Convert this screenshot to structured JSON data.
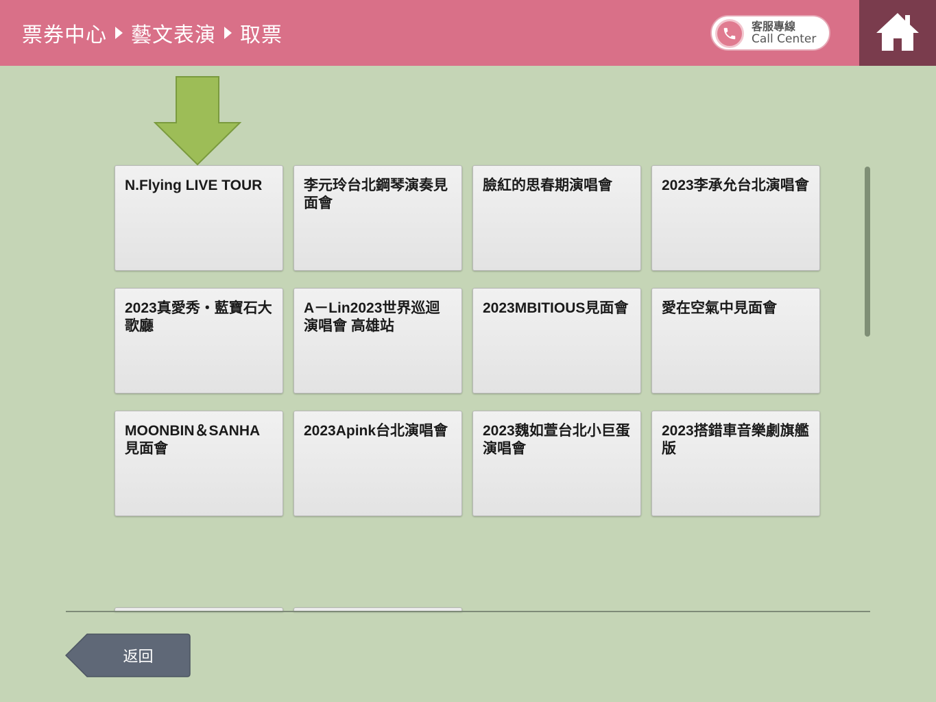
{
  "header": {
    "breadcrumb": [
      "票券中心",
      "藝文表演",
      "取票"
    ],
    "call_center": {
      "label_zh": "客服專線",
      "label_en": "Call Center",
      "icon": "phone-icon"
    },
    "home_icon": "home-icon"
  },
  "hint_arrow": {
    "icon": "down-arrow-icon",
    "color": "#9dbd57"
  },
  "events": [
    "N.Flying LIVE TOUR",
    "李元玲台北鋼琴演奏見面會",
    "臉紅的思春期演唱會",
    "2023李承允台北演唱會",
    "2023真愛秀‧藍寶石大歌廳",
    "A－Lin2023世界巡迴演唱會 高雄站",
    "2023MBITIOUS見面會",
    "愛在空氣中見面會",
    "MOONBIN＆SANHA見面會",
    "2023Apink台北演唱會",
    "2023魏如萱台北小巨蛋演唱會",
    "2023搭錯車音樂劇旗艦版"
  ],
  "footer": {
    "back_label": "返回"
  },
  "colors": {
    "header": "#d97088",
    "home_bg": "#7a3c4d",
    "background": "#c5d5b6",
    "back_button": "#5f6877"
  }
}
